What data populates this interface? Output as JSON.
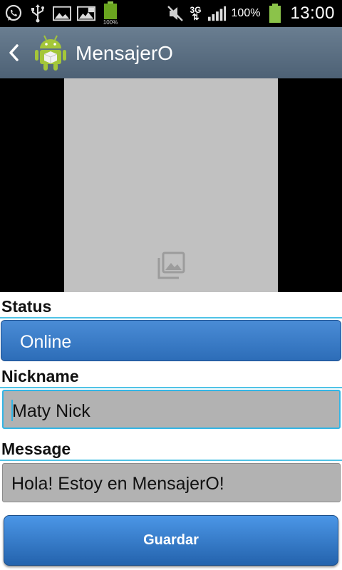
{
  "status_bar": {
    "left_icons": [
      "whatsapp-icon",
      "usb-icon",
      "gallery-notification-icon",
      "screenshot-icon",
      "battery-full-notification-icon"
    ],
    "battery_small_label": "100%",
    "network_type": "3G",
    "battery_percent": "100%",
    "time": "13:00"
  },
  "action_bar": {
    "title": "MensajerO"
  },
  "form": {
    "status_label": "Status",
    "status_value": "Online",
    "nickname_label": "Nickname",
    "nickname_value": "Maty Nick",
    "message_label": "Message",
    "message_value": "Hola! Estoy en MensajerO!",
    "save_label": "Guardar"
  },
  "colors": {
    "accent": "#33b5e5",
    "button_blue": "#2d6db8",
    "action_bar": "#5a6e82",
    "field_bg": "#b2b2b2",
    "image_placeholder": "#c1c1c1"
  }
}
